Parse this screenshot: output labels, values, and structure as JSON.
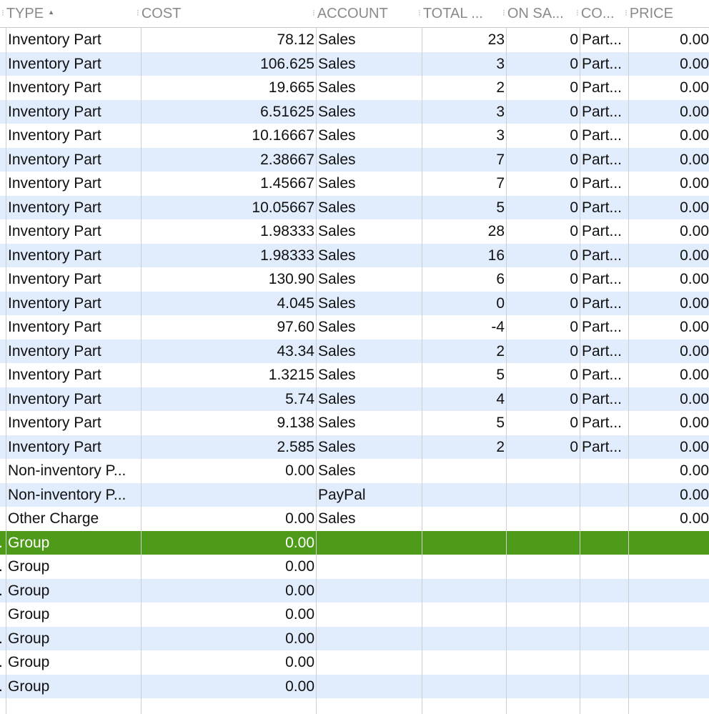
{
  "columns": [
    "TYPE",
    "COST",
    "ACCOUNT",
    "TOTAL ...",
    "ON SA...",
    "CO...",
    "PRICE"
  ],
  "sort": {
    "column": "TYPE",
    "direction": "ascending"
  },
  "rows": [
    [
      "",
      "Inventory Part",
      "78.12",
      "Sales",
      "23",
      "0",
      "Part...",
      "0.00"
    ],
    [
      "",
      "Inventory Part",
      "106.625",
      "Sales",
      "3",
      "0",
      "Part...",
      "0.00"
    ],
    [
      "",
      "Inventory Part",
      "19.665",
      "Sales",
      "2",
      "0",
      "Part...",
      "0.00"
    ],
    [
      "",
      "Inventory Part",
      "6.51625",
      "Sales",
      "3",
      "0",
      "Part...",
      "0.00"
    ],
    [
      "",
      "Inventory Part",
      "10.16667",
      "Sales",
      "3",
      "0",
      "Part...",
      "0.00"
    ],
    [
      "",
      "Inventory Part",
      "2.38667",
      "Sales",
      "7",
      "0",
      "Part...",
      "0.00"
    ],
    [
      "",
      "Inventory Part",
      "1.45667",
      "Sales",
      "7",
      "0",
      "Part...",
      "0.00"
    ],
    [
      "",
      "Inventory Part",
      "10.05667",
      "Sales",
      "5",
      "0",
      "Part...",
      "0.00"
    ],
    [
      "",
      "Inventory Part",
      "1.98333",
      "Sales",
      "28",
      "0",
      "Part...",
      "0.00"
    ],
    [
      "",
      "Inventory Part",
      "1.98333",
      "Sales",
      "16",
      "0",
      "Part...",
      "0.00"
    ],
    [
      "",
      "Inventory Part",
      "130.90",
      "Sales",
      "6",
      "0",
      "Part...",
      "0.00"
    ],
    [
      "",
      "Inventory Part",
      "4.045",
      "Sales",
      "0",
      "0",
      "Part...",
      "0.00"
    ],
    [
      "",
      "Inventory Part",
      "97.60",
      "Sales",
      "-4",
      "0",
      "Part...",
      "0.00"
    ],
    [
      "",
      "Inventory Part",
      "43.34",
      "Sales",
      "2",
      "0",
      "Part...",
      "0.00"
    ],
    [
      "",
      "Inventory Part",
      "1.3215",
      "Sales",
      "5",
      "0",
      "Part...",
      "0.00"
    ],
    [
      "",
      "Inventory Part",
      "5.74",
      "Sales",
      "4",
      "0",
      "Part...",
      "0.00"
    ],
    [
      "",
      "Inventory Part",
      "9.138",
      "Sales",
      "5",
      "0",
      "Part...",
      "0.00"
    ],
    [
      "",
      "Inventory Part",
      "2.585",
      "Sales",
      "2",
      "0",
      "Part...",
      "0.00"
    ],
    [
      "",
      "Non-inventory P...",
      "0.00",
      "Sales",
      "",
      "",
      "",
      "0.00"
    ],
    [
      "",
      "Non-inventory P...",
      "",
      "PayPal",
      "",
      "",
      "",
      "0.00"
    ],
    [
      "",
      "Other Charge",
      "0.00",
      "Sales",
      "",
      "",
      "",
      "0.00"
    ],
    [
      ".",
      "Group",
      "0.00",
      "",
      "",
      "",
      "",
      ""
    ],
    [
      ".",
      "Group",
      "0.00",
      "",
      "",
      "",
      "",
      ""
    ],
    [
      ".",
      "Group",
      "0.00",
      "",
      "",
      "",
      "",
      ""
    ],
    [
      "",
      "Group",
      "0.00",
      "",
      "",
      "",
      "",
      ""
    ],
    [
      ".",
      "Group",
      "0.00",
      "",
      "",
      "",
      "",
      ""
    ],
    [
      ".",
      "Group",
      "0.00",
      "",
      "",
      "",
      "",
      ""
    ],
    [
      ".",
      "Group",
      "0.00",
      "",
      "",
      "",
      "",
      ""
    ]
  ],
  "selected_row": 21,
  "colors": {
    "selected": "#4e9b1a",
    "stripe": "#e1edfd"
  }
}
